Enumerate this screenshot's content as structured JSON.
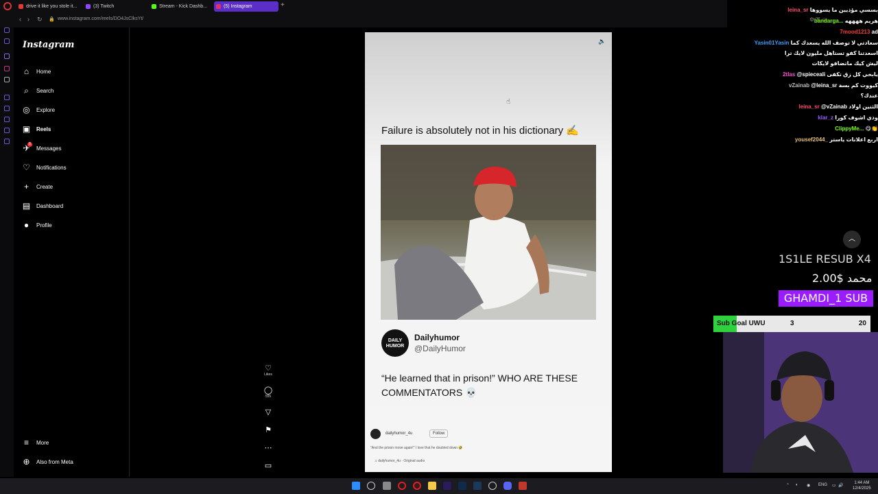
{
  "browser": {
    "tabs": [
      {
        "title": "drive it like you stole it...",
        "icon_color": "#e53935"
      },
      {
        "title": "(3) Twitch",
        "icon_color": "#9146ff"
      },
      {
        "title": "Stream - Kick Dashb...",
        "icon_color": "#53fc18"
      },
      {
        "title": "(5) Instagram",
        "icon_color": "#e1306c"
      }
    ],
    "url": "www.instagram.com/reels/DO4JsClksYt/",
    "add_tab_label": "+"
  },
  "instagram": {
    "logo": "Instagram",
    "nav": [
      {
        "label": "Home",
        "icon": "home-icon",
        "glyph": "⌂"
      },
      {
        "label": "Search",
        "icon": "search-icon",
        "glyph": "⌕"
      },
      {
        "label": "Explore",
        "icon": "compass-icon",
        "glyph": "◎"
      },
      {
        "label": "Reels",
        "icon": "reels-icon",
        "glyph": "▣"
      },
      {
        "label": "Messages",
        "icon": "messages-icon",
        "glyph": "✈",
        "badge": "5"
      },
      {
        "label": "Notifications",
        "icon": "heart-icon",
        "glyph": "♡"
      },
      {
        "label": "Create",
        "icon": "plus-icon",
        "glyph": "+"
      },
      {
        "label": "Dashboard",
        "icon": "dashboard-icon",
        "glyph": "▤"
      },
      {
        "label": "Profile",
        "icon": "profile-icon",
        "glyph": "●"
      }
    ],
    "bottom": [
      {
        "label": "More",
        "icon": "menu-icon",
        "glyph": "≡"
      },
      {
        "label": "Also from Meta",
        "icon": "meta-icon",
        "glyph": "⊕"
      }
    ]
  },
  "reel": {
    "top_caption": "Failure is absolutely not in his dictionary ✍️",
    "card_name": "Dailyhumor",
    "card_handle": "@DailyHumor",
    "card_avatar_text": "DAILY HUMOR",
    "quote": "“He learned that in prison!” WHO ARE THESE COMMENTATORS 💀",
    "footer_user": "dailyhumor_4u",
    "footer_follow": "Follow",
    "footer_caption": "\"And the prison move again!\" I love that he doubled down 🤣",
    "footer_audio": "dailyhumor_4u · Original audio",
    "actions": [
      {
        "icon": "like-icon",
        "glyph": "♡",
        "count": "Likes"
      },
      {
        "icon": "comment-icon",
        "glyph": "◯",
        "count": "555"
      },
      {
        "icon": "share-icon",
        "glyph": "▽",
        "count": ""
      },
      {
        "icon": "save-icon",
        "glyph": "⚑",
        "count": ""
      },
      {
        "icon": "more-icon",
        "glyph": "⋯",
        "count": ""
      },
      {
        "icon": "audio-thumb-icon",
        "glyph": "▭",
        "count": ""
      }
    ]
  },
  "chat": [
    {
      "user": "leina_sr",
      "color": "#ff4d6d",
      "msg": "بسسي مؤذيين ما يسووها"
    },
    {
      "user": "bandarga...",
      "color": "#7CFC00",
      "msg": "هريم ههههه"
    },
    {
      "user": "7mood1213",
      "color": "#ff3b3b",
      "msg": "ad"
    },
    {
      "user": "Yasin01Yasin",
      "color": "#3aa0ff",
      "msg": "سعادتي لا توصف الله يسعدك كما"
    },
    {
      "user": "",
      "color": "#fff",
      "msg": "اسعدتنا كفو تستاهل مليون لايك ترا"
    },
    {
      "user": "",
      "color": "#fff",
      "msg": "ليش كيك ماتضافو لايكات"
    },
    {
      "user": "2tlas",
      "color": "#ff4fd8",
      "msg": "@spieceali يابخي كل زق تكفى"
    },
    {
      "user": "vZainab",
      "color": "#bbbbbb",
      "msg": "@leina_sr كيووت كم بسة"
    },
    {
      "user": "",
      "color": "#fff",
      "msg": "عندك؟"
    },
    {
      "user": "leina_sr",
      "color": "#ff4d6d",
      "msg": "@vZainab الثنين اولاد"
    },
    {
      "user": "klar_z",
      "color": "#9b59ff",
      "msg": "ودي اشوف كورا"
    },
    {
      "user": "ClippyMe...",
      "color": "#7CFC00",
      "msg": "😋👏"
    },
    {
      "user": "yousef2044_",
      "color": "#e8c07a",
      "msg": "اربع اعلانات ياستر"
    }
  ],
  "alerts": {
    "line1": "1S1LE  RESUB X4",
    "line2": "محمد  $2.00",
    "line3": "GHAMDI_1 SUB"
  },
  "sub_goal": {
    "label": "Sub Goal UWU",
    "current": "3",
    "target": "20",
    "progress_fraction": 0.15
  },
  "taskbar": {
    "lang": "ENG",
    "time": "1:44 AM",
    "date": "12/4/2025"
  }
}
